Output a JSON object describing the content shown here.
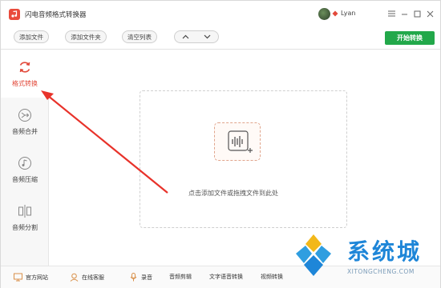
{
  "titlebar": {
    "title": "闪电音频格式转换器",
    "user_name": "Lyan",
    "min_icon": "minimize-icon",
    "max_icon": "maximize-icon",
    "close_icon": "close-icon"
  },
  "toolbar": {
    "add_file": "添加文件",
    "add_folder": "添加文件夹",
    "clear_list": "清空列表",
    "start": "开始转换"
  },
  "sidebar": {
    "items": [
      {
        "label": "格式转换",
        "active": true
      },
      {
        "label": "音频合并",
        "active": false
      },
      {
        "label": "音频压缩",
        "active": false
      },
      {
        "label": "音频分割",
        "active": false
      }
    ]
  },
  "main": {
    "drop_hint": "点击添加文件或拖拽文件到此处"
  },
  "bottombar": {
    "website": "官方网站",
    "support": "在线客服",
    "record": "录音",
    "audio_cut": "音频剪辑",
    "tts": "文字语音转换",
    "video_convert": "视频转换"
  },
  "watermark": {
    "title": "系统城",
    "sub": "XITONGCHENG.COM"
  },
  "colors": {
    "accent_red": "#e24a3b",
    "start_green": "#22a84a",
    "watermark_blue": "#1e86d8"
  }
}
